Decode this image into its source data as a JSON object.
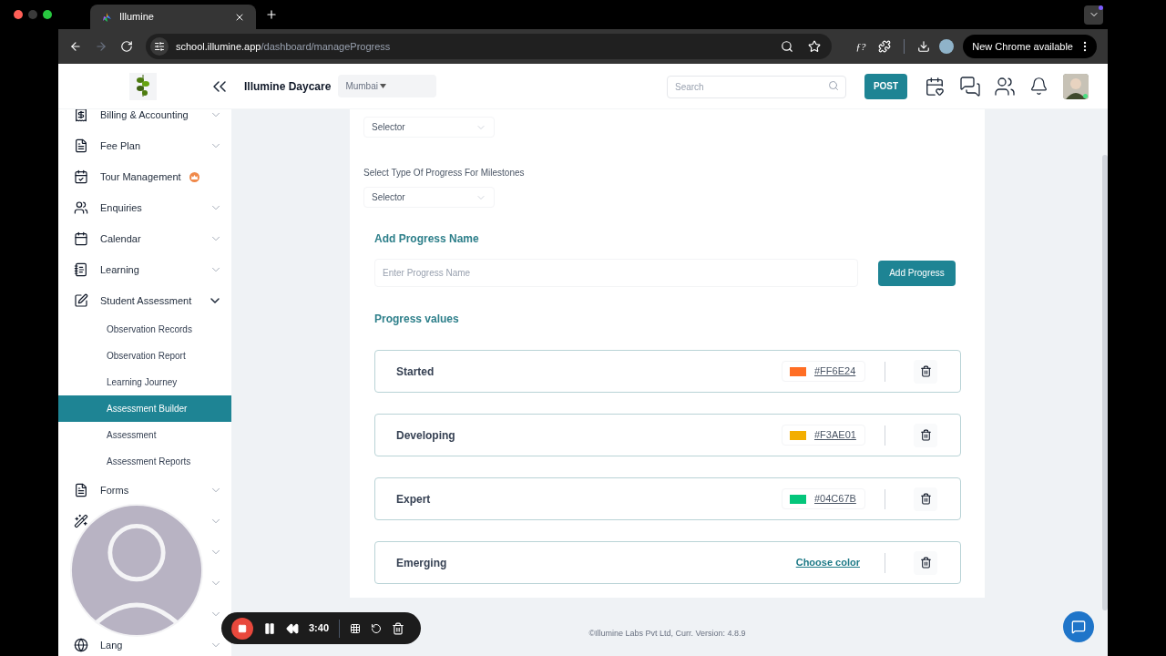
{
  "browser": {
    "tab_title": "Illumine",
    "url_domain": "school.illumine.app",
    "url_path": "/dashboard/manageProgress",
    "update_label": "New Chrome available",
    "extension_glyph": "ƒ?"
  },
  "header": {
    "school": "Illumine Daycare",
    "location": "Mumbai",
    "search_placeholder": "Search",
    "post_label": "POST"
  },
  "sidebar": {
    "items": [
      {
        "kind": "expandable",
        "label": "Billing & Accounting",
        "expanded": false
      },
      {
        "kind": "expandable",
        "label": "Fee Plan",
        "expanded": false
      },
      {
        "kind": "badge",
        "label": "Tour Management"
      },
      {
        "kind": "expandable",
        "label": "Enquiries",
        "expanded": false
      },
      {
        "kind": "expandable",
        "label": "Calendar",
        "expanded": false
      },
      {
        "kind": "expandable",
        "label": "Learning",
        "expanded": false
      },
      {
        "kind": "expandable",
        "label": "Student Assessment",
        "expanded": true,
        "children": [
          {
            "label": "Observation Records",
            "selected": false
          },
          {
            "label": "Observation Report",
            "selected": false
          },
          {
            "label": "Learning Journey",
            "selected": false
          },
          {
            "label": "Assessment Builder",
            "selected": true
          },
          {
            "label": "Assessment",
            "selected": false
          },
          {
            "label": "Assessment Reports",
            "selected": false
          }
        ]
      },
      {
        "kind": "expandable",
        "label": "Forms",
        "expanded": false
      },
      {
        "kind": "expandable",
        "expanded": false
      },
      {
        "kind": "expandable",
        "expanded": false
      },
      {
        "kind": "expandable",
        "expanded": false
      },
      {
        "kind": "expandable",
        "expanded": false
      },
      {
        "kind": "expandable",
        "label": "Lang",
        "expanded": false
      }
    ]
  },
  "form": {
    "selector_1": "Selector",
    "milestone_label": "Select Type Of Progress For Milestones",
    "selector_2": "Selector",
    "add_heading": "Add Progress Name",
    "name_placeholder": "Enter Progress Name",
    "add_button": "Add Progress",
    "values_heading": "Progress values",
    "values": [
      {
        "name": "Started",
        "color": "#ff6e24",
        "hex": "#FF6E24"
      },
      {
        "name": "Developing",
        "color": "#f3ae01",
        "hex": "#F3AE01"
      },
      {
        "name": "Expert",
        "color": "#04c67b",
        "hex": "#04C67B"
      },
      {
        "name": "Emerging",
        "choose_label": "Choose color"
      }
    ]
  },
  "footer": "©Illumine Labs Pvt Ltd, Curr. Version: 4.8.9",
  "recorder": {
    "time": "3:40"
  }
}
